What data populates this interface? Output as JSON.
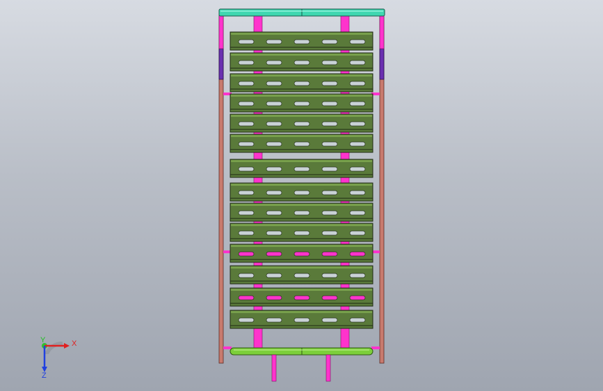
{
  "scene": {
    "colors": {
      "background_top": "#d7dbe2",
      "background_bottom": "#9fa5b0",
      "frame_post": "#c87a6e",
      "bracket": "#ff33cc",
      "tray_fill": "#5a7a3a",
      "tray_highlight": "#78a04c",
      "tray_edge": "#1f2a12",
      "slot_light": "#c9d2d6",
      "slot_pink": "#ff33cc",
      "top_beam": "#3fd7b0",
      "bottom_beam": "#7ccf3a",
      "side_brace": "#6b2fb0",
      "foot": "#ff33cc"
    },
    "trays": [
      {
        "slot_color": "light"
      },
      {
        "slot_color": "light"
      },
      {
        "slot_color": "light"
      },
      {
        "slot_color": "light"
      },
      {
        "slot_color": "light"
      },
      {
        "slot_color": "light"
      },
      {
        "slot_color": "light"
      },
      {
        "slot_color": "light"
      },
      {
        "slot_color": "light"
      },
      {
        "slot_color": "light"
      },
      {
        "slot_color": "pink"
      },
      {
        "slot_color": "light"
      },
      {
        "slot_color": "pink"
      },
      {
        "slot_color": "light"
      }
    ]
  },
  "triad": {
    "x_label": "X",
    "y_label": "Y",
    "z_label": "Z",
    "x_color": "#e02020",
    "y_color": "#20c020",
    "z_color": "#2040e0"
  }
}
